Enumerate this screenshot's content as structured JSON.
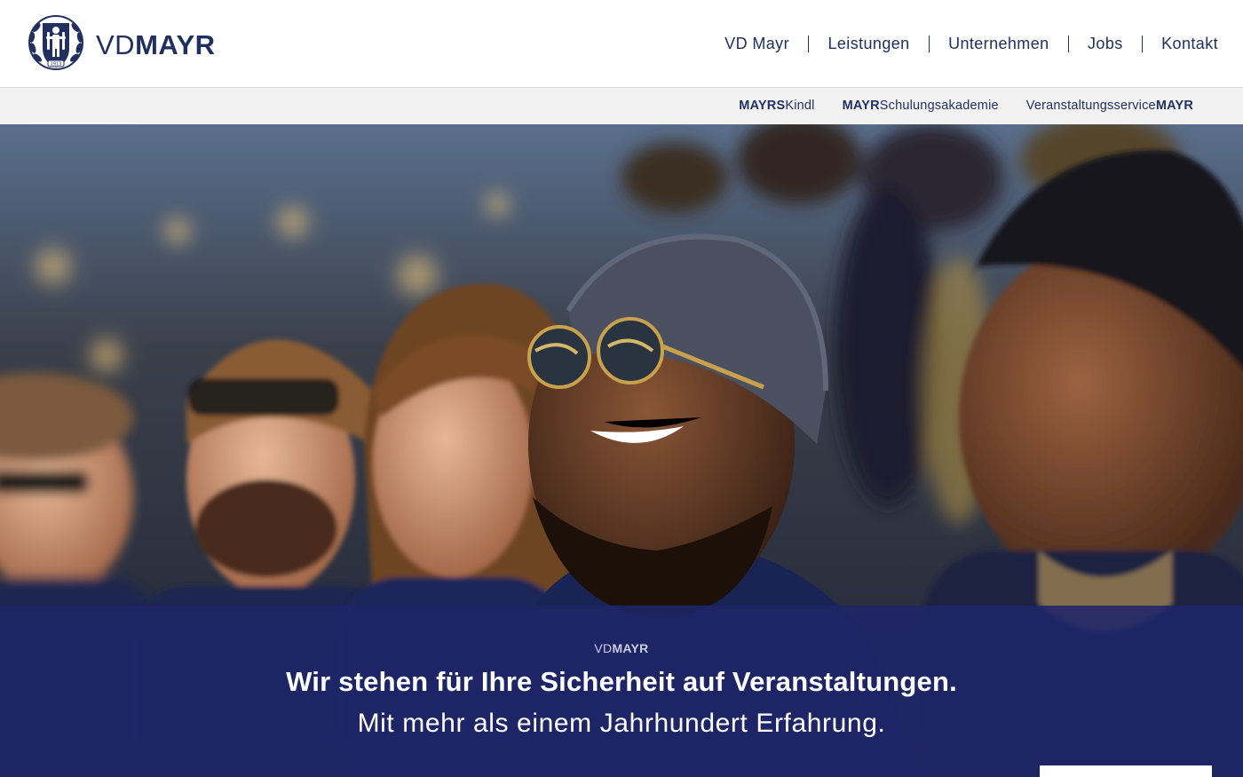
{
  "header": {
    "logo": {
      "prefix": "VD",
      "name": "MAYR",
      "icon": "crest-emblem-icon",
      "crest_year": "1913"
    },
    "nav": [
      {
        "label": "VD Mayr"
      },
      {
        "label": "Leistungen"
      },
      {
        "label": "Unternehmen"
      },
      {
        "label": "Jobs"
      },
      {
        "label": "Kontakt"
      }
    ]
  },
  "subnav": {
    "items": [
      {
        "bold": "MAYRS",
        "regular": "Kindl",
        "order": "bold-first"
      },
      {
        "bold": "MAYR",
        "regular": "Schulungsakademie",
        "order": "bold-first"
      },
      {
        "regular": "Veranstaltungsservice",
        "bold": "MAYR",
        "order": "regular-first"
      }
    ]
  },
  "hero": {
    "image": "stadium-crowd-photo",
    "band": {
      "label_prefix": "VD",
      "label_name": "MAYR",
      "title": "Wir stehen für Ihre Sicherheit auf Veranstaltungen.",
      "subtitle": "Mit mehr als einem Jahrhundert Erfahrung.",
      "button_label": ""
    }
  },
  "colors": {
    "brand_navy": "#22305f",
    "band_overlay": "#1e2669",
    "subnav_bg": "#f2f2f2",
    "white": "#ffffff"
  }
}
